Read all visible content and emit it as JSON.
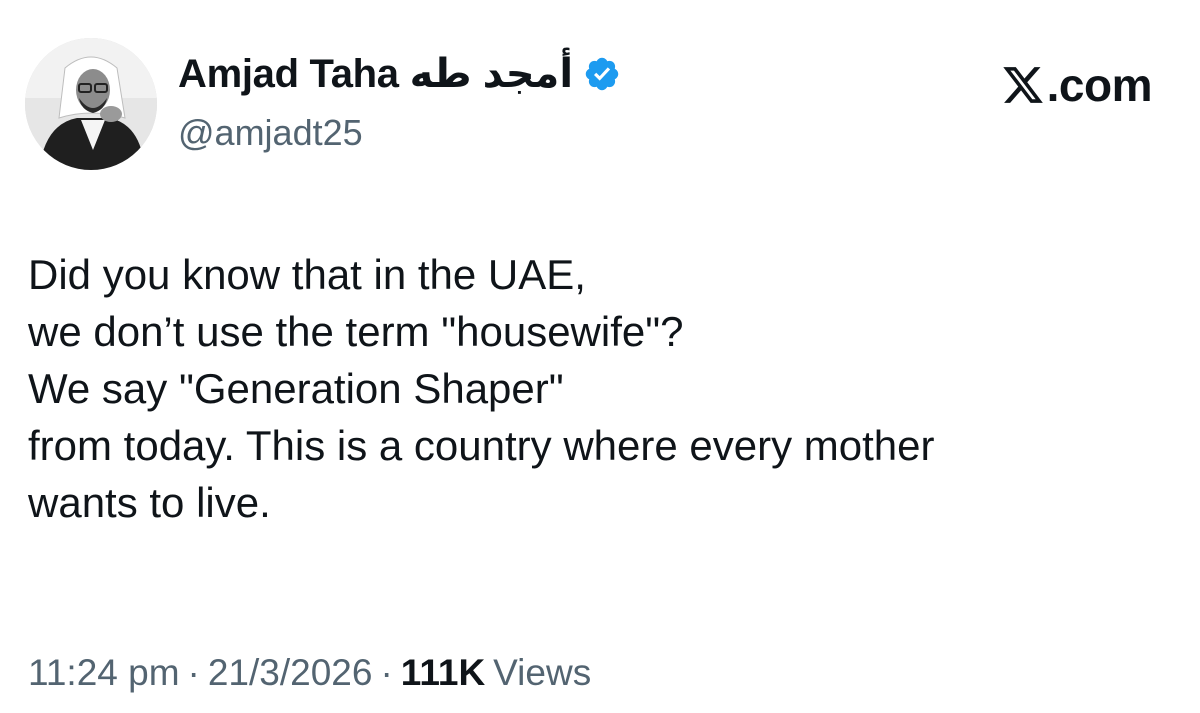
{
  "author": {
    "display_name": "Amjad Taha أمجد طه",
    "handle": "@amjadt25",
    "verified_color": "#1d9bf0"
  },
  "brand": {
    "text": ".com",
    "icon": "x-logo-icon"
  },
  "tweet": {
    "lines": [
      "Did you know that in the UAE,",
      "we don’t use the term \"housewife\"?",
      "We say \"Generation Shaper\"",
      "from today. This is a country where every mother",
      "wants to live."
    ]
  },
  "meta": {
    "time": "11:24 pm",
    "separator": "·",
    "date": "21/3/2026",
    "views_count": "111K",
    "views_label": "Views"
  }
}
